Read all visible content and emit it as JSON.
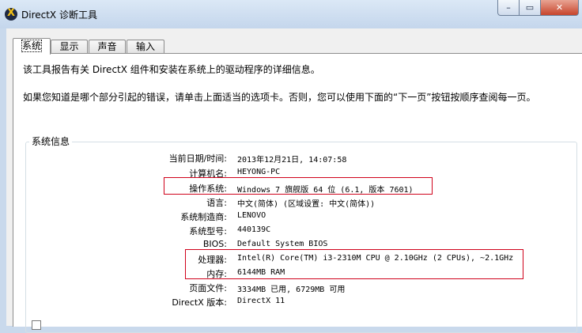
{
  "window": {
    "title": "DirectX 诊断工具",
    "minimize": "–",
    "maximize": "▭",
    "close": "✕"
  },
  "tabs": [
    {
      "label": "系统",
      "active": true
    },
    {
      "label": "显示",
      "active": false
    },
    {
      "label": "声音",
      "active": false
    },
    {
      "label": "输入",
      "active": false
    }
  ],
  "intro": {
    "line1": "该工具报告有关 DirectX 组件和安装在系统上的驱动程序的详细信息。",
    "line2": "如果您知道是哪个部分引起的错误，请单击上面适当的选项卡。否则，您可以使用下面的“下一页”按钮按顺序查阅每一页。"
  },
  "system_info": {
    "title": "系统信息",
    "rows": [
      {
        "label": "当前日期/时间:",
        "value": "2013年12月21日, 14:07:58"
      },
      {
        "label": "计算机名:",
        "value": "HEYONG-PC"
      },
      {
        "label": "操作系统:",
        "value": "Windows 7 旗舰版 64 位 (6.1, 版本 7601)"
      },
      {
        "label": "语言:",
        "value": "中文(简体) (区域设置: 中文(简体))"
      },
      {
        "label": "系统制造商:",
        "value": "LENOVO"
      },
      {
        "label": "系统型号:",
        "value": "440139C"
      },
      {
        "label": "BIOS:",
        "value": "Default System BIOS"
      },
      {
        "label": "处理器:",
        "value": "Intel(R) Core(TM) i3-2310M CPU @ 2.10GHz (2 CPUs), ~2.1GHz"
      },
      {
        "label": "内存:",
        "value": "6144MB RAM"
      },
      {
        "label": "页面文件:",
        "value": "3334MB 已用, 6729MB 可用"
      },
      {
        "label": "DirectX 版本:",
        "value": "DirectX 11"
      }
    ]
  },
  "colors": {
    "highlight": "#d0021b",
    "titlebar": "#c4d6ec",
    "close_button": "#c7452c"
  }
}
